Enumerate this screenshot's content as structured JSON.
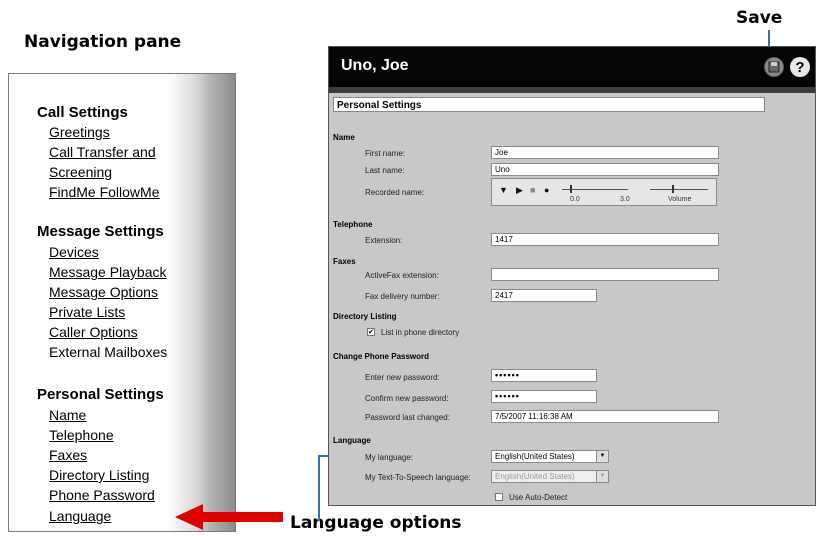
{
  "callouts": {
    "navigation": "Navigation pane",
    "save": "Save",
    "language": "Language options"
  },
  "nav": {
    "sections": [
      {
        "title": "Call Settings",
        "items": [
          "Greetings",
          "Call Transfer and",
          "Screening",
          "FindMe FollowMe"
        ]
      },
      {
        "title": "Message Settings",
        "items": [
          "Devices",
          "Message Playback",
          "Message Options",
          "Private Lists",
          "Caller Options",
          "External Mailboxes"
        ]
      },
      {
        "title": "Personal Settings",
        "items": [
          "Name",
          "Telephone",
          "Faxes",
          "Directory Listing",
          "Phone Password",
          "Language"
        ]
      }
    ]
  },
  "app": {
    "title": "Uno, Joe",
    "save_icon": "save-icon",
    "help_icon": "help-icon",
    "help_glyph": "?",
    "panel_title": "Personal Settings",
    "name": {
      "heading": "Name",
      "first_label": "First name:",
      "first_value": "Joe",
      "last_label": "Last name:",
      "last_value": "Uno",
      "recorded_label": "Recorded name:",
      "pos_start": "0.0",
      "pos_end": "3.0",
      "volume_label": "Volume"
    },
    "telephone": {
      "heading": "Telephone",
      "ext_label": "Extension:",
      "ext_value": "1417"
    },
    "faxes": {
      "heading": "Faxes",
      "activefax_label": "ActiveFax extension:",
      "activefax_value": "",
      "delivery_label": "Fax delivery number:",
      "delivery_value": "2417"
    },
    "directory": {
      "heading": "Directory Listing",
      "list_label": "List in phone directory",
      "list_checked": true
    },
    "password": {
      "heading": "Change Phone Password",
      "new_label": "Enter new password:",
      "new_value": "••••••",
      "confirm_label": "Confirm new password:",
      "confirm_value": "••••••",
      "changed_label": "Password last changed:",
      "changed_value": "7/5/2007 11:16:38 AM"
    },
    "language": {
      "heading": "Language",
      "my_label": "My language:",
      "my_value": "English(United States)",
      "tts_label": "My Text-To-Speech language:",
      "tts_value": "English(United States)",
      "auto_label": "Use Auto-Detect",
      "auto_checked": false
    }
  },
  "colors": {
    "header": "#050505",
    "panel": "#c8c8c8",
    "arrow": "#e00000",
    "leader": "#3a6db5"
  }
}
